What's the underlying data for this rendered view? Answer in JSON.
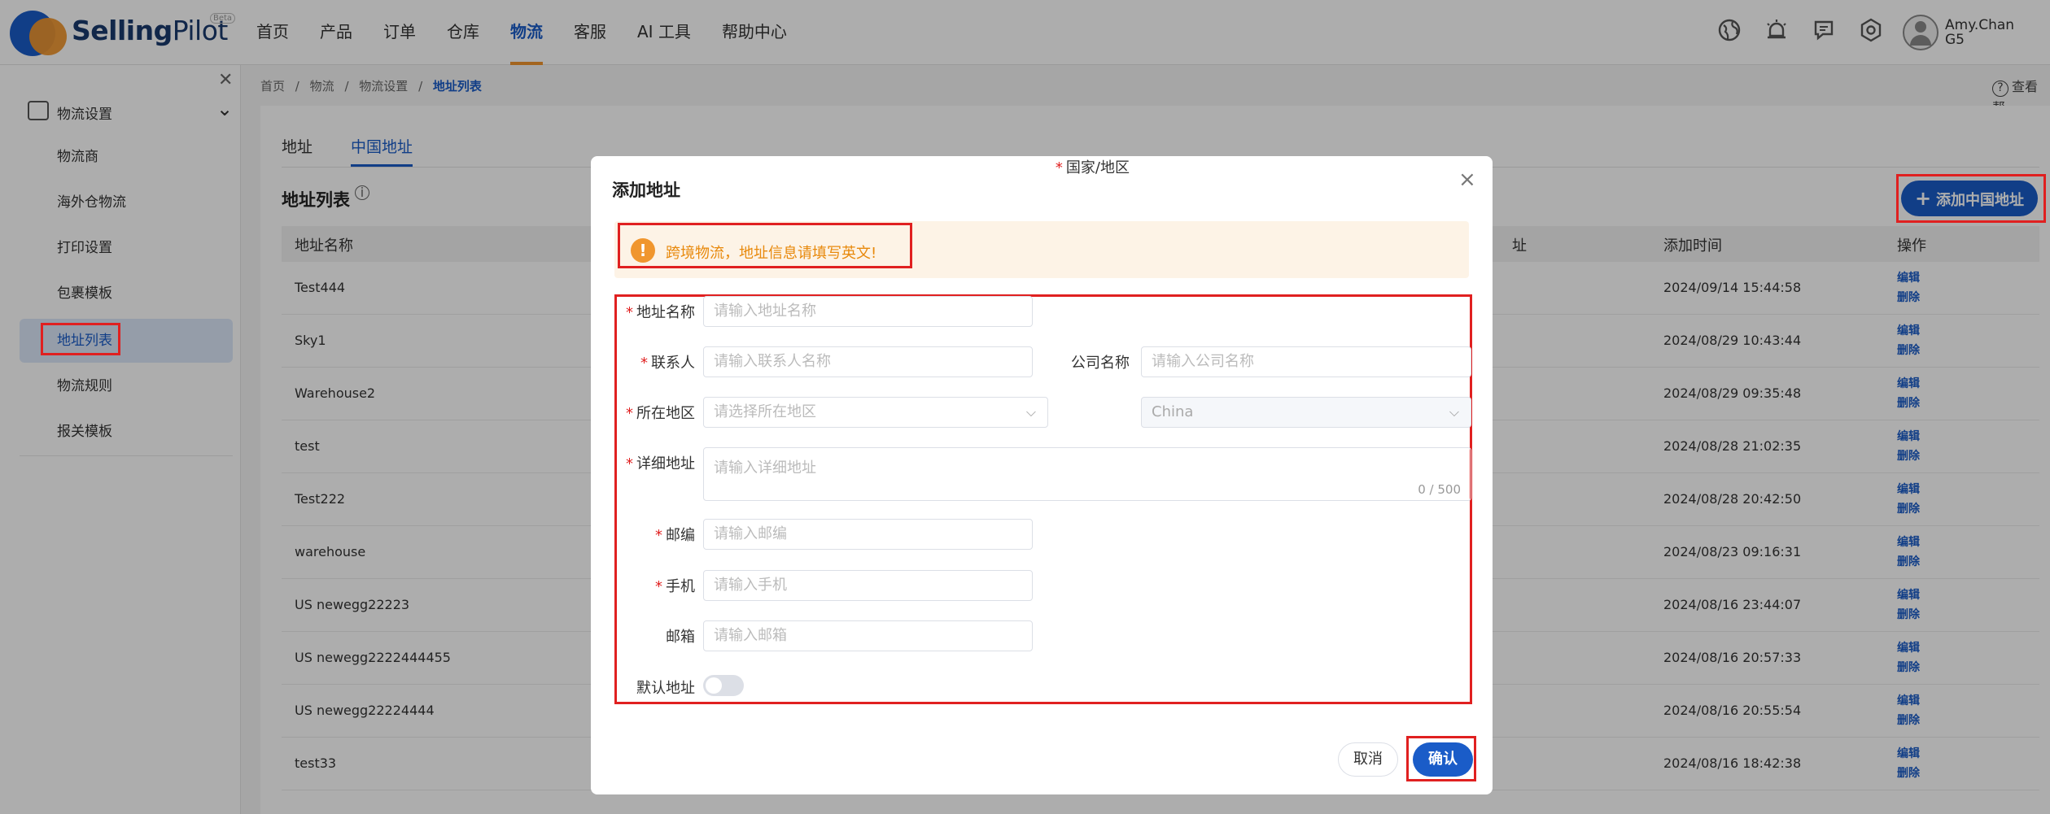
{
  "app": {
    "brand_bold": "Selling",
    "brand_rest": "Pilot",
    "beta": "Beta"
  },
  "topnav": {
    "menu": [
      "首页",
      "产品",
      "订单",
      "仓库",
      "物流",
      "客服",
      "AI 工具",
      "帮助中心"
    ],
    "active_index": 4,
    "user": {
      "name": "Amy.Chan",
      "code": "G5"
    }
  },
  "sidebar": {
    "section": "物流设置",
    "items": [
      "物流商",
      "海外仓物流",
      "打印设置",
      "包裹模板",
      "地址列表",
      "物流规则",
      "报关模板"
    ],
    "active_index": 4
  },
  "breadcrumb": [
    "首页",
    "/",
    "物流",
    "/",
    "物流设置",
    "/",
    "地址列表"
  ],
  "help_link": "查看帮",
  "page": {
    "tabs": [
      "地址",
      "中国地址"
    ],
    "active_tab": 1,
    "list_title": "地址列表",
    "add_button": "添加中国地址",
    "table": {
      "headers": [
        "地址名称",
        "址",
        "添加时间",
        "操作"
      ],
      "rows": [
        {
          "name": "Test444",
          "time": "2024/09/14 15:44:58"
        },
        {
          "name": "Sky1",
          "time": "2024/08/29 10:43:44"
        },
        {
          "name": "Warehouse2",
          "time": "2024/08/29 09:35:48"
        },
        {
          "name": "test",
          "time": "2024/08/28 21:02:35"
        },
        {
          "name": "Test222",
          "time": "2024/08/28 20:42:50"
        },
        {
          "name": "warehouse",
          "time": "2024/08/23 09:16:31"
        },
        {
          "name": "US newegg22223",
          "time": "2024/08/16 23:44:07"
        },
        {
          "name": "US newegg2222444455",
          "time": "2024/08/16 20:57:33"
        },
        {
          "name": "US newegg22224444",
          "time": "2024/08/16 20:55:54"
        },
        {
          "name": "test33",
          "time": "2024/08/16 18:42:38"
        }
      ],
      "op_edit": "编辑",
      "op_delete": "删除"
    }
  },
  "modal": {
    "title": "添加地址",
    "warning": "跨境物流，地址信息请填写英文!",
    "fields": {
      "address_name": {
        "label": "地址名称",
        "placeholder": "请输入地址名称"
      },
      "contact": {
        "label": "联系人",
        "placeholder": "请输入联系人名称"
      },
      "company": {
        "label": "公司名称",
        "placeholder": "请输入公司名称"
      },
      "region": {
        "label": "所在地区",
        "placeholder": "请选择所在地区"
      },
      "country": {
        "label": "国家/地区",
        "value": "China"
      },
      "detail": {
        "label": "详细地址",
        "placeholder": "请输入详细地址",
        "counter": "0 / 500"
      },
      "zip": {
        "label": "邮编",
        "placeholder": "请输入邮编"
      },
      "phone": {
        "label": "手机",
        "placeholder": "请输入手机"
      },
      "email": {
        "label": "邮箱",
        "placeholder": "请输入邮箱"
      },
      "default": {
        "label": "默认地址"
      }
    },
    "cancel": "取消",
    "confirm": "确认"
  },
  "colors": {
    "primary": "#1a5cc8",
    "accent": "#f0962e",
    "highlight": "#e02020"
  }
}
